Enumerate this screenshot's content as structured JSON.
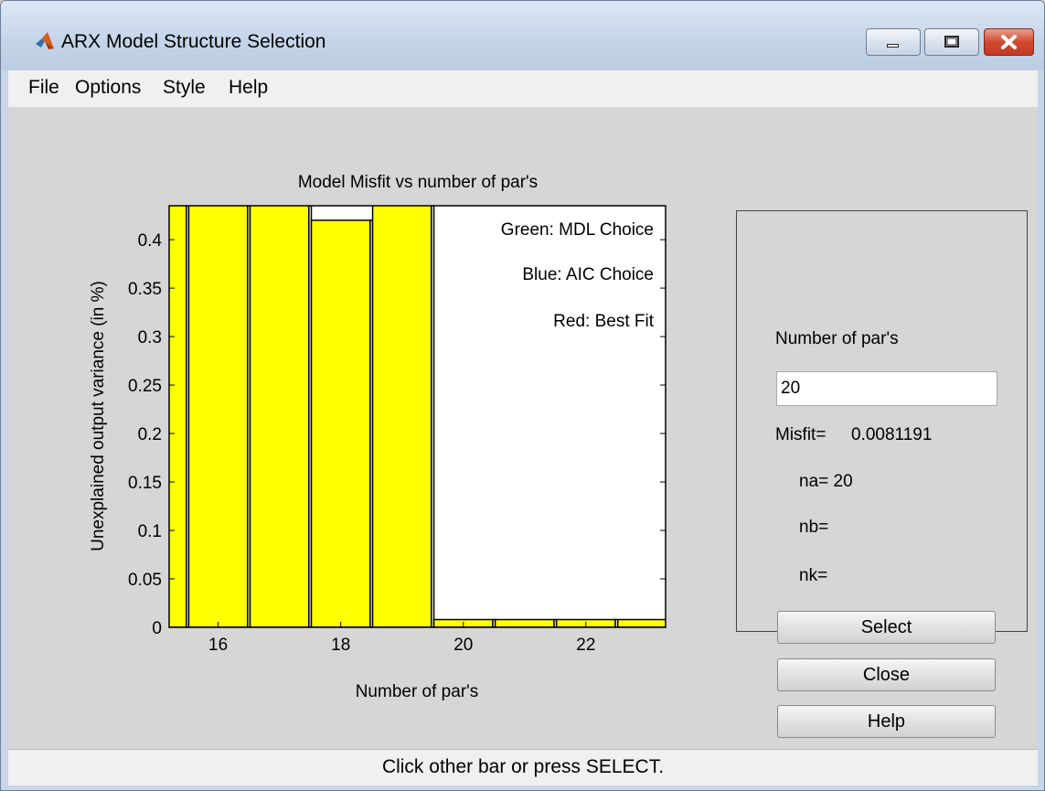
{
  "window": {
    "title": "ARX Model Structure Selection",
    "app_icon": "matlab-logo-icon",
    "controls": [
      "minimize-icon",
      "maximize-icon",
      "close-icon"
    ]
  },
  "menubar": {
    "items": [
      {
        "label": "File"
      },
      {
        "label": "Options"
      },
      {
        "label": "Style"
      },
      {
        "label": "Help"
      }
    ]
  },
  "chart_data": {
    "type": "bar",
    "title": "Model Misfit vs number of par's",
    "xlabel": "Number of par's",
    "ylabel": "Unexplained output variance (in %)",
    "xticks": [
      "16",
      "18",
      "20",
      "22"
    ],
    "yticks": [
      "0",
      "0.05",
      "0.1",
      "0.15",
      "0.2",
      "0.25",
      "0.3",
      "0.35",
      "0.4"
    ],
    "xlim": [
      15.2,
      23.3
    ],
    "ylim": [
      0,
      0.435
    ],
    "background_color": "#ffff00",
    "bar_fill": "#ffff00",
    "bar_edge": "#000000",
    "x": [
      15,
      16,
      17,
      18,
      19,
      20,
      21,
      22,
      23
    ],
    "values": [
      0.6,
      0.6,
      0.6,
      0.42,
      0.6,
      0.008,
      0.008,
      0.008,
      0.008
    ],
    "legend": [
      "Green: MDL Choice",
      "Blue: AIC Choice",
      "Red: Best Fit"
    ],
    "legend_position": "top-right"
  },
  "panel": {
    "npars_label": "Number of par's",
    "npars_value": "20",
    "misfit_label": "Misfit=",
    "misfit_value": "0.0081191",
    "na_text": "na= 20",
    "nb_text": "nb=",
    "nk_text": "nk=",
    "select_label": "Select",
    "close_label": "Close",
    "help_label": "Help"
  },
  "status": {
    "text": "Click other bar or press SELECT."
  },
  "colors": {
    "content_bg": "#d6d6d6",
    "menubar_bg": "#f0f0f0",
    "bar_yellow": "#ffff00"
  }
}
